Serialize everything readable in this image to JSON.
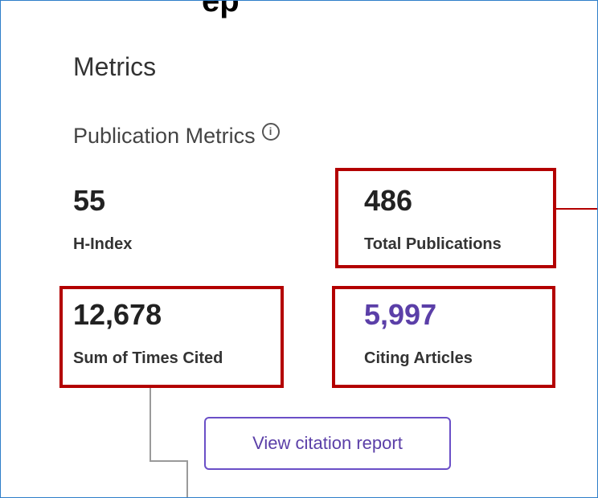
{
  "header": {
    "clipped_heading": "ep"
  },
  "metrics": {
    "title": "Metrics",
    "subtitle": "Publication Metrics",
    "info_icon_glyph": "i",
    "h_index": {
      "value": "55",
      "label": "H-Index"
    },
    "total_publications": {
      "value": "486",
      "label": "Total Publications"
    },
    "sum_times_cited": {
      "value": "12,678",
      "label": "Sum of Times Cited"
    },
    "citing_articles": {
      "value": "5,997",
      "label": "Citing Articles"
    },
    "view_report_button": "View citation report"
  },
  "colors": {
    "highlight": "#b30000",
    "link_purple": "#5b3fa8",
    "frame_border": "#2f7ec9"
  }
}
